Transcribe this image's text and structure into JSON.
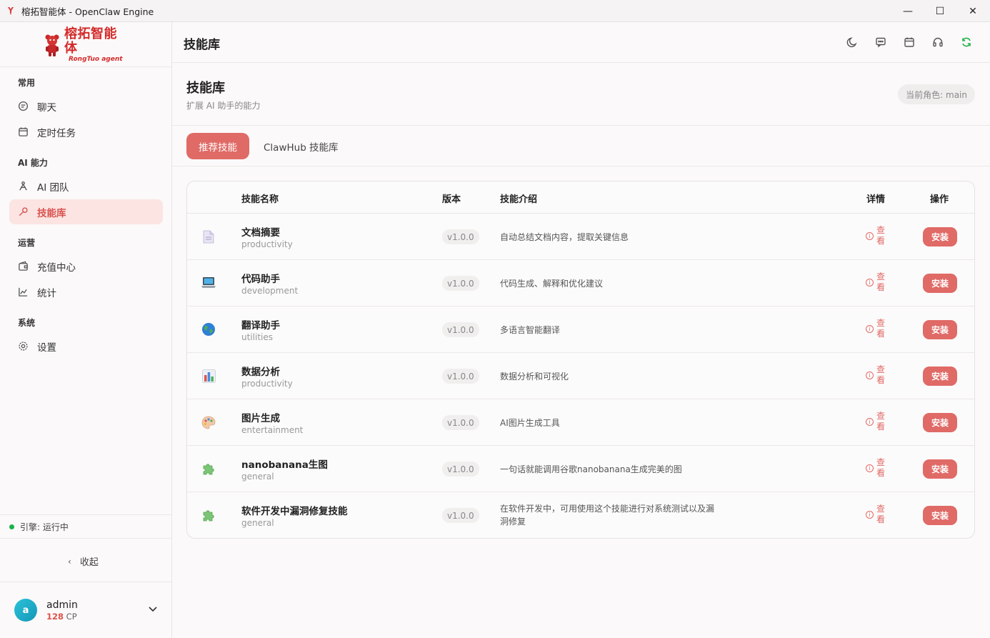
{
  "window": {
    "title": "榕拓智能体 - OpenClaw Engine",
    "controls": {
      "minimize": "—",
      "maximize": "☐",
      "close": "✕"
    }
  },
  "brand": {
    "name_cn": "榕拓智能体",
    "name_en": "RongTuo agent"
  },
  "sidebar": {
    "sections": [
      {
        "title": "常用",
        "items": [
          {
            "label": "聊天",
            "icon": "chat-icon"
          },
          {
            "label": "定时任务",
            "icon": "calendar-icon"
          }
        ]
      },
      {
        "title": "AI 能力",
        "items": [
          {
            "label": "AI 团队",
            "icon": "team-icon"
          },
          {
            "label": "技能库",
            "icon": "wrench-icon",
            "active": true
          }
        ]
      },
      {
        "title": "运营",
        "items": [
          {
            "label": "充值中心",
            "icon": "wallet-icon"
          },
          {
            "label": "统计",
            "icon": "chart-icon"
          }
        ]
      },
      {
        "title": "系统",
        "items": [
          {
            "label": "设置",
            "icon": "gear-icon"
          }
        ]
      }
    ],
    "engine_status": "引擎: 运行中",
    "collapse_label": "收起",
    "user": {
      "avatar_letter": "a",
      "name": "admin",
      "credits": "128",
      "credits_unit": "CP"
    }
  },
  "topbar": {
    "title": "技能库",
    "icons": [
      "moon-icon",
      "message-icon",
      "calendar-icon",
      "headset-icon",
      "refresh-icon"
    ]
  },
  "header": {
    "title": "技能库",
    "subtitle": "扩展 AI 助手的能力",
    "role_badge": "当前角色: main"
  },
  "tabs": [
    {
      "label": "推荐技能",
      "active": true
    },
    {
      "label": "ClawHub 技能库",
      "active": false
    }
  ],
  "table": {
    "columns": {
      "name": "技能名称",
      "version": "版本",
      "description": "技能介绍",
      "details": "详情",
      "actions": "操作"
    },
    "detail_label": "查看",
    "install_label": "安装",
    "rows": [
      {
        "icon": "document-icon",
        "name": "文档摘要",
        "category": "productivity",
        "version": "v1.0.0",
        "description": "自动总结文档内容，提取关键信息"
      },
      {
        "icon": "laptop-icon",
        "name": "代码助手",
        "category": "development",
        "version": "v1.0.0",
        "description": "代码生成、解释和优化建议"
      },
      {
        "icon": "globe-icon",
        "name": "翻译助手",
        "category": "utilities",
        "version": "v1.0.0",
        "description": "多语言智能翻译"
      },
      {
        "icon": "bar-chart-icon",
        "name": "数据分析",
        "category": "productivity",
        "version": "v1.0.0",
        "description": "数据分析和可视化"
      },
      {
        "icon": "palette-icon",
        "name": "图片生成",
        "category": "entertainment",
        "version": "v1.0.0",
        "description": "AI图片生成工具"
      },
      {
        "icon": "puzzle-icon",
        "name": "nanobanana生图",
        "category": "general",
        "version": "v1.0.0",
        "description": "一句话就能调用谷歌nanobanana生成完美的图"
      },
      {
        "icon": "puzzle-icon",
        "name": "软件开发中漏洞修复技能",
        "category": "general",
        "version": "v1.0.0",
        "description": "在软件开发中，可用使用这个技能进行对系统测试以及漏洞修复"
      }
    ]
  }
}
